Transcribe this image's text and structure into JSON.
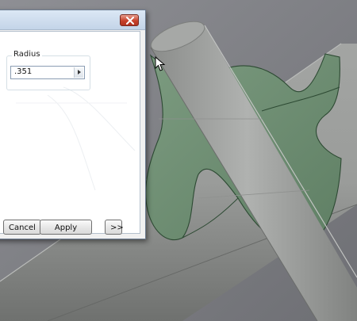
{
  "dialog": {
    "radius_group_label": "Radius",
    "radius_value": ".351",
    "cancel_label": "Cancel",
    "apply_label": "Apply",
    "more_label": ">>"
  },
  "icons": {
    "close": "close-icon",
    "spin_right": "chevron-right-icon",
    "cursor": "mouse-pointer-icon"
  },
  "colors": {
    "background": "#7f8086",
    "cylinder": "#9a9c9a",
    "fillet": "#6f8f74",
    "fillet_edge": "#2d4a33",
    "close_button": "#c7412b"
  }
}
